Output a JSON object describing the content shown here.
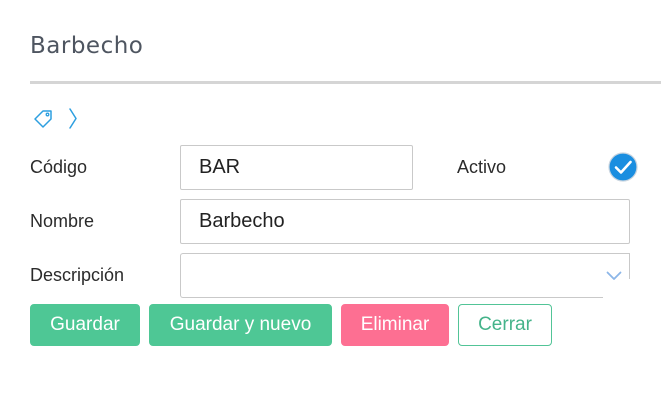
{
  "page": {
    "title": "Barbecho"
  },
  "breadcrumb": {
    "icon": "tag-icon",
    "separator_icon": "chevron-right-icon"
  },
  "form": {
    "codigo": {
      "label": "Código",
      "value": "BAR"
    },
    "activo": {
      "label": "Activo",
      "checked": true
    },
    "nombre": {
      "label": "Nombre",
      "value": "Barbecho"
    },
    "descripcion": {
      "label": "Descripción",
      "value": ""
    }
  },
  "actions": {
    "save_label": "Guardar",
    "save_new_label": "Guardar y nuevo",
    "delete_label": "Eliminar",
    "close_label": "Cerrar"
  },
  "colors": {
    "primary": "#4ec795",
    "danger": "#fd6f92",
    "accent_blue": "#2d9fe0",
    "check_blue": "#1a8ee0"
  }
}
